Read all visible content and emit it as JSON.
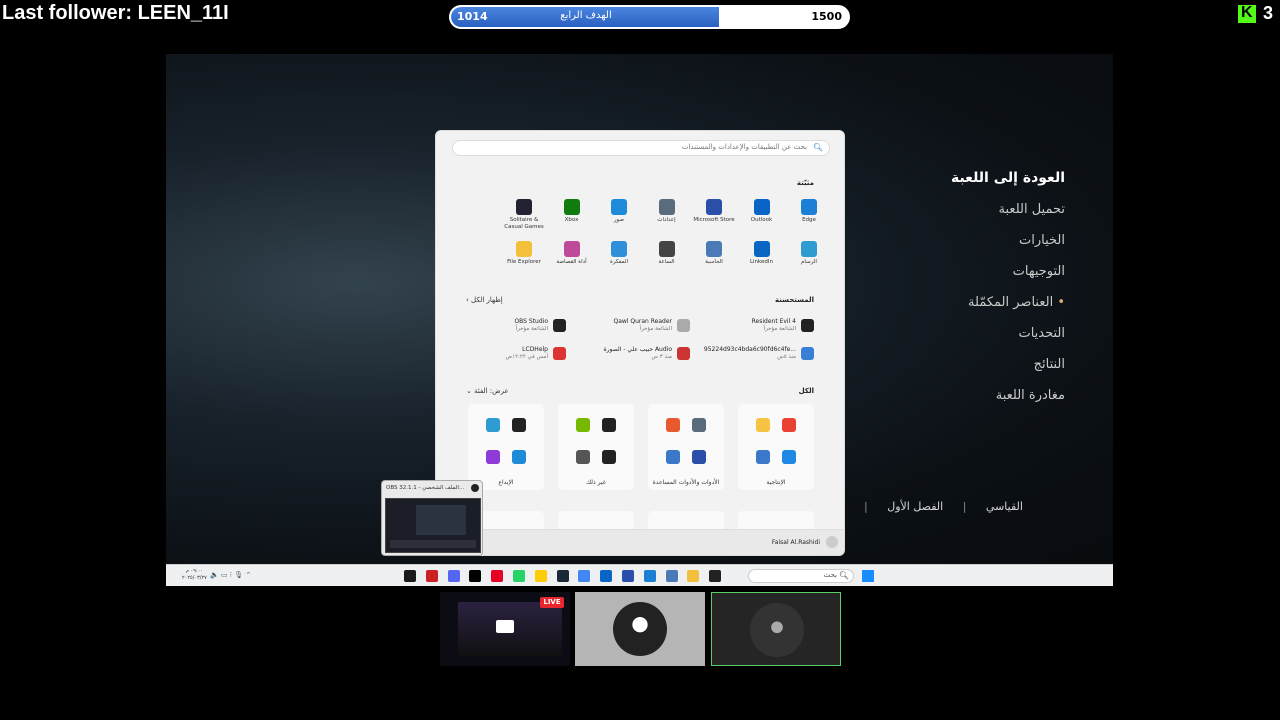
{
  "overlay": {
    "last_follower": "Last follower: LEEN_11I",
    "goal_current": "1014",
    "goal_target": "1500",
    "goal_title": "الهدف الرابع",
    "goal_progress": 0.676,
    "viewer_count": "3"
  },
  "game_menu": {
    "items": [
      "العودة إلى اللعبة",
      "تحميل اللعبة",
      "الخيارات",
      "التوجيهات",
      "العناصر المكمّلة",
      "التحديات",
      "النتائج",
      "مغادرة اللعبة"
    ],
    "footer": [
      "الفصل الأول",
      "القياسي"
    ]
  },
  "start_menu": {
    "search_placeholder": "بحث عن التطبيقات والإعدادات والمستندات",
    "pinned_title": "مثبّتة",
    "pinned": [
      {
        "label": "Edge",
        "icon": "edge-icon",
        "color": "#1b7fd6"
      },
      {
        "label": "Outlook",
        "icon": "outlook-icon",
        "color": "#0a64c8"
      },
      {
        "label": "Microsoft Store",
        "icon": "store-icon",
        "color": "#2b4fa8"
      },
      {
        "label": "إعدادات",
        "icon": "settings-icon",
        "color": "#5a6b7b"
      },
      {
        "label": "صور",
        "icon": "photos-icon",
        "color": "#1e8bd8"
      },
      {
        "label": "Xbox",
        "icon": "xbox-icon",
        "color": "#107c10"
      },
      {
        "label": "Solitaire & Casual Games",
        "icon": "solitaire-icon",
        "color": "#223"
      },
      {
        "label": "الرسام",
        "icon": "paint-icon",
        "color": "#2e9bd1"
      },
      {
        "label": "LinkedIn",
        "icon": "linkedin-icon",
        "color": "#0a66c2"
      },
      {
        "label": "الحاسبة",
        "icon": "calculator-icon",
        "color": "#4a7ab8"
      },
      {
        "label": "الساعة",
        "icon": "clock-icon",
        "color": "#444"
      },
      {
        "label": "المفكرة",
        "icon": "notepad-icon",
        "color": "#2f8fd8"
      },
      {
        "label": "أداة القصاصة",
        "icon": "snipping-icon",
        "color": "#c04a9a"
      },
      {
        "label": "File Explorer",
        "icon": "folder-icon",
        "color": "#f3c03b"
      }
    ],
    "recommended_title": "المستحسنة",
    "show_all": "إظهار الكل",
    "recommended": [
      {
        "title": "Resident Evil 4",
        "sub": "الشائعة مؤخراً",
        "icon": "re4-icon",
        "color": "#222"
      },
      {
        "title": "Qawl Quran Reader",
        "sub": "الشائعة مؤخراً",
        "icon": "quran-icon",
        "color": "#aaa"
      },
      {
        "title": "OBS Studio",
        "sub": "الشائعة مؤخراً",
        "icon": "obs-icon",
        "color": "#222"
      },
      {
        "title": "95224d93c4bda6c90fd6c4fe...",
        "sub": "منذ ٥س",
        "icon": "file-icon",
        "color": "#3a7fd6"
      },
      {
        "title": "حبيب علي - الصورة Audio",
        "sub": "منذ ٣ س",
        "icon": "audio-icon",
        "color": "#c33"
      },
      {
        "title": "LCDHelp",
        "sub": "أمس في ١٢:٢٢ص",
        "icon": "pdf-icon",
        "color": "#d33"
      }
    ],
    "all_title": "الكل",
    "view_category": "عرض: الفئة",
    "folders": [
      {
        "label": "الإنتاجية",
        "icons": [
          "#f5c542",
          "#e94235",
          "#3a78c9",
          "#1e88e5"
        ]
      },
      {
        "label": "الأدوات والأدوات المساعدة",
        "icons": [
          "#e85a2d",
          "#5a6b7b",
          "#3a78c9",
          "#2b4fa8"
        ]
      },
      {
        "label": "غير ذلك",
        "icons": [
          "#76b900",
          "#222",
          "#555",
          "#222"
        ]
      },
      {
        "label": "الإبداع",
        "icons": [
          "#2e9bd1",
          "#222",
          "#8d3ad8",
          "#1e8bd8"
        ]
      }
    ],
    "user_name": "Faisal Al.Rashidi"
  },
  "obs_thumbnail": {
    "title": "OBS 32.1.1 - الملف الشخصي..."
  },
  "taskbar": {
    "search_placeholder": "بحث",
    "clock_time": "٠٩:٠٠ م",
    "clock_date": "٢٠٢٥/٠٣/٢٧",
    "apps": [
      "#1a1a1a",
      "#c22",
      "#5865f2",
      "#000",
      "#e60023",
      "#25d366",
      "#ffcc00",
      "#1b2838",
      "#4285f4",
      "#0a64c8",
      "#2b4fa8",
      "#1b7fd6",
      "#4a7ab8",
      "#f3c03b",
      "#222"
    ]
  },
  "cams": {
    "live_label": "LIVE"
  }
}
